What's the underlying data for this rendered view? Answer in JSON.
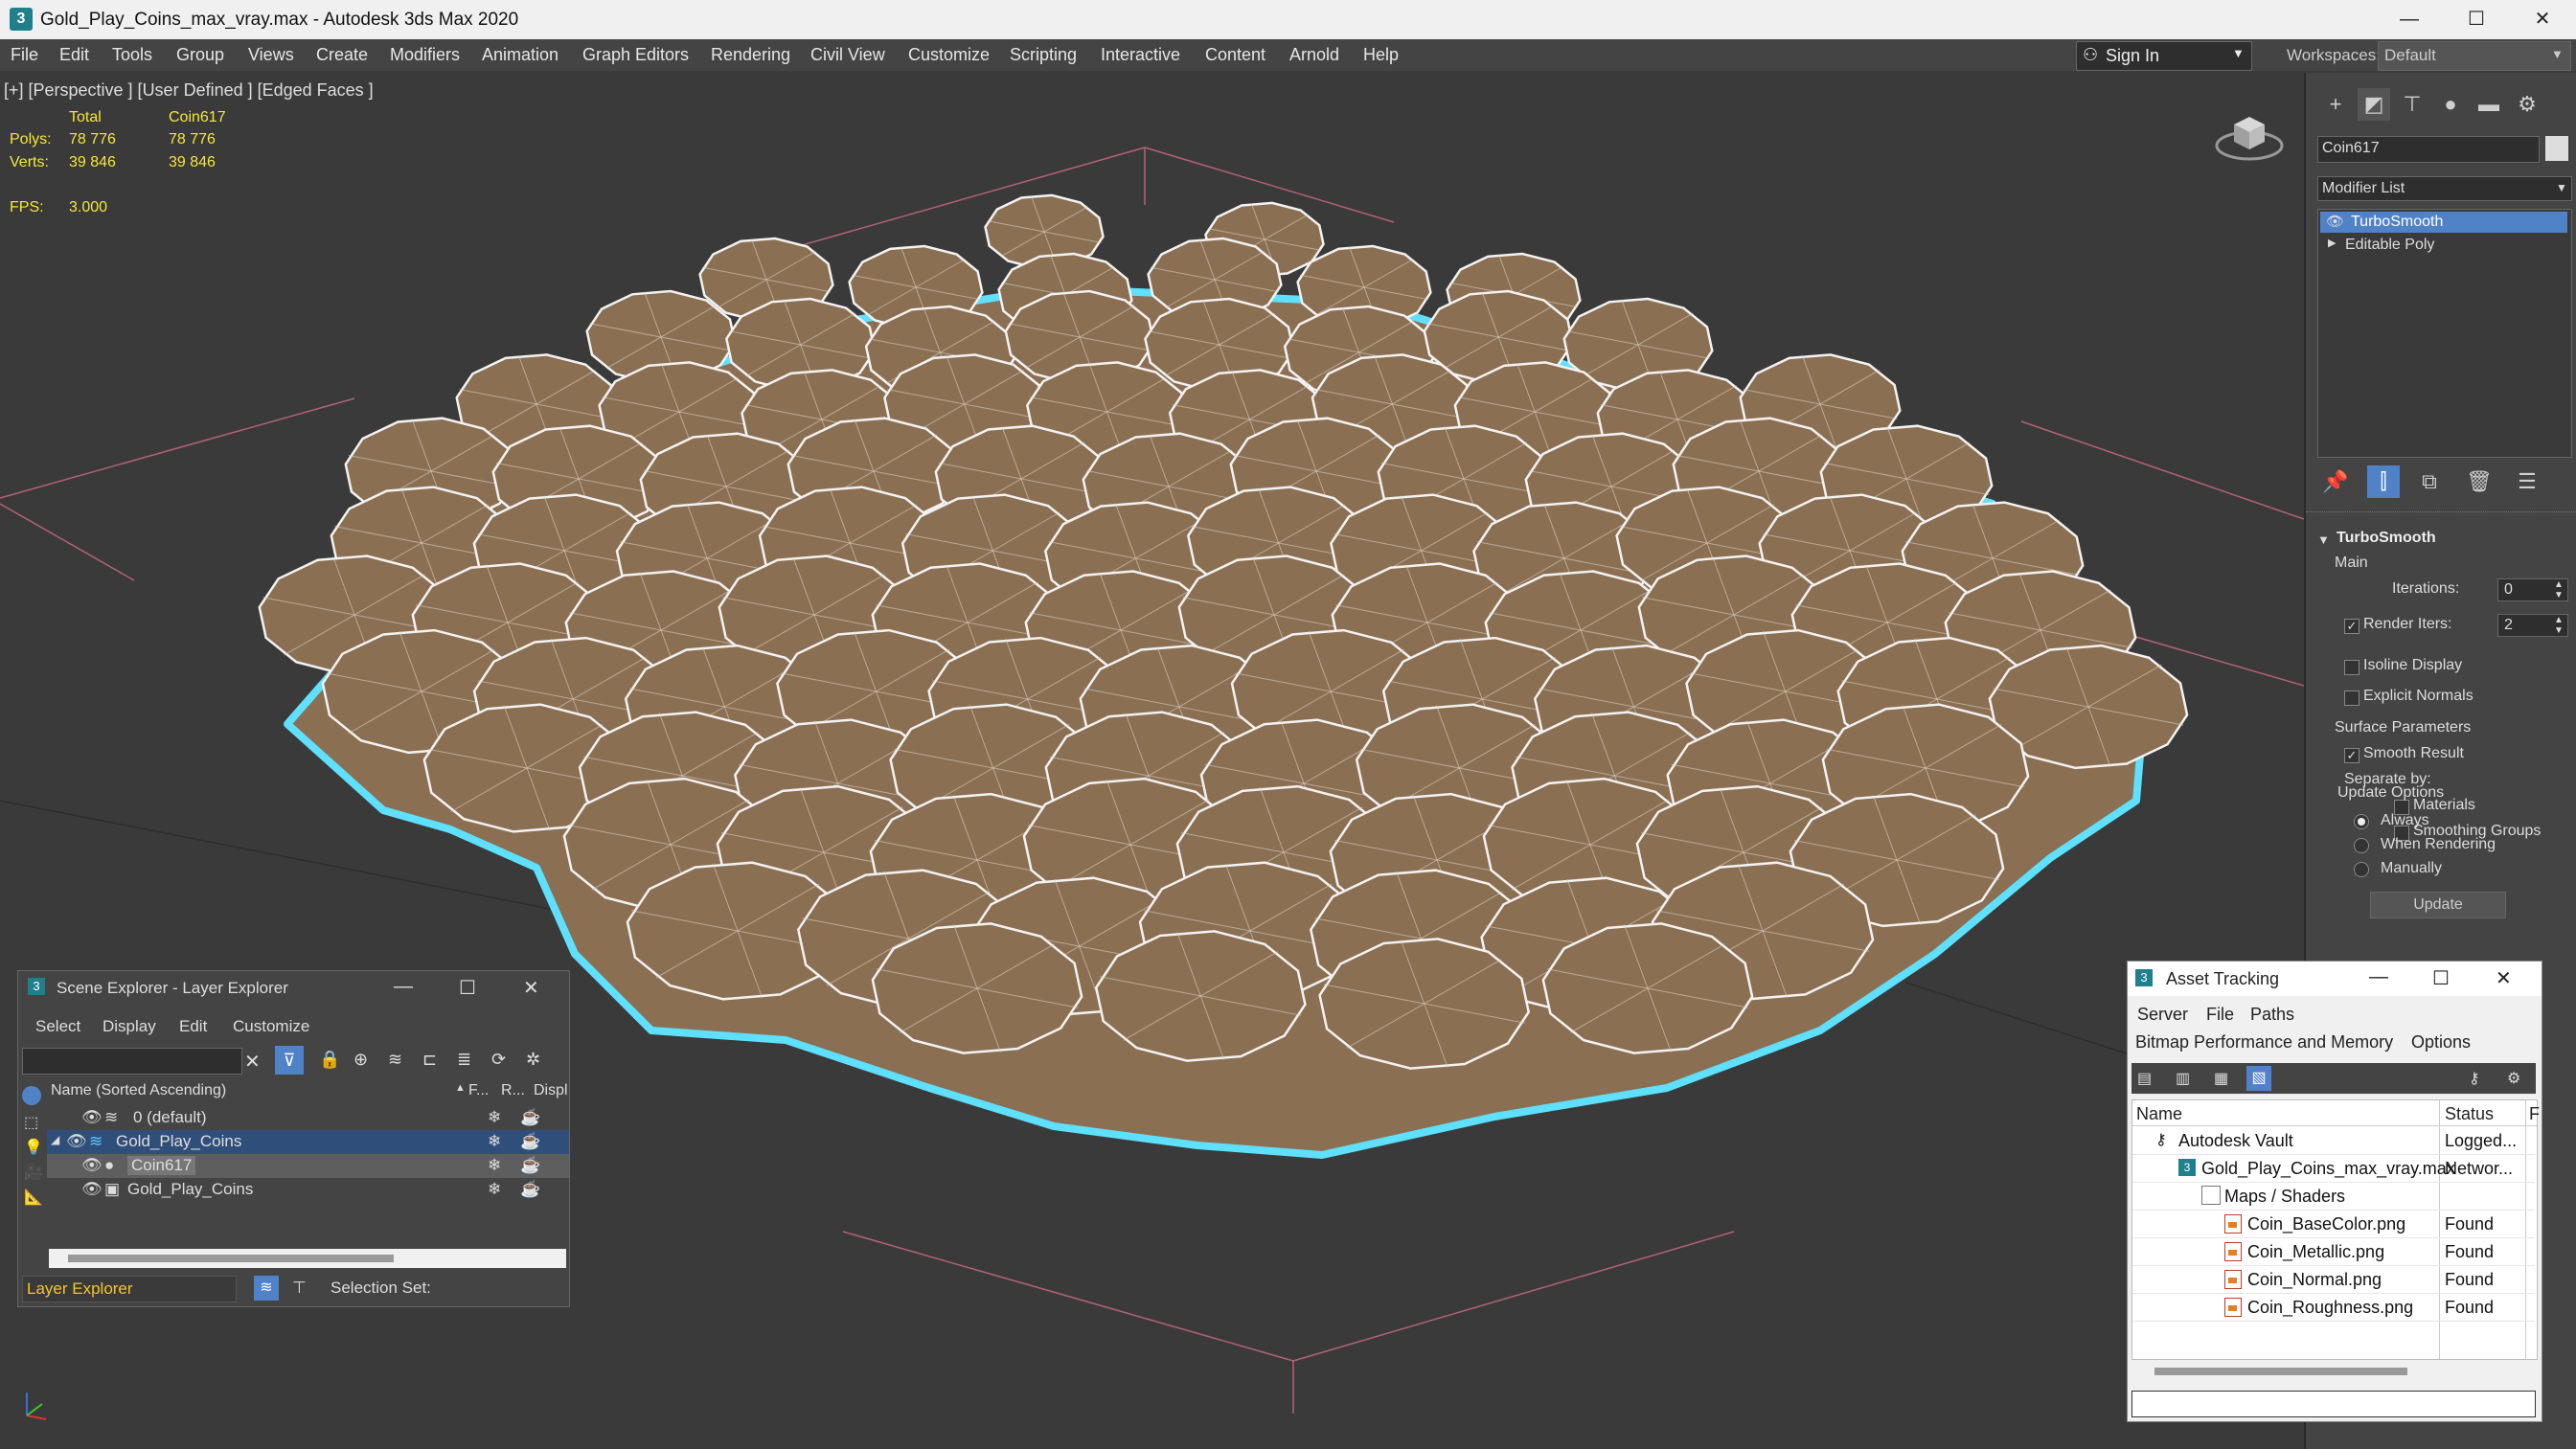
{
  "window": {
    "title": "Gold_Play_Coins_max_vray.max - Autodesk 3ds Max 2020",
    "app_icon_glyph": "3",
    "controls": {
      "minimize": "—",
      "maximize": "☐",
      "close": "✕"
    }
  },
  "menu": {
    "items": [
      "File",
      "Edit",
      "Tools",
      "Group",
      "Views",
      "Create",
      "Modifiers",
      "Animation",
      "Graph Editors",
      "Rendering",
      "Civil View",
      "Customize",
      "Scripting",
      "Interactive",
      "Content",
      "Arnold",
      "Help"
    ],
    "sign_in": "Sign In",
    "workspaces_label": "Workspaces:",
    "workspace_value": "Default"
  },
  "viewport": {
    "label": "[+] [Perspective ] [User Defined ] [Edged Faces ]",
    "stats": {
      "col_total": "Total",
      "col_object": "Coin617",
      "polys_label": "Polys:",
      "polys_total": "78 776",
      "polys_object": "78 776",
      "verts_label": "Verts:",
      "verts_total": "39 846",
      "verts_object": "39 846",
      "fps_label": "FPS:",
      "fps_value": "3.000"
    },
    "coin_color": "#8b6f52",
    "selection_color": "#5fe0ff"
  },
  "command_panel": {
    "object_name": "Coin617",
    "modifier_list": "Modifier List",
    "stack": [
      "TurboSmooth",
      "Editable Poly"
    ],
    "rollout_title": "TurboSmooth",
    "main_label": "Main",
    "iterations_label": "Iterations:",
    "iterations_value": "0",
    "render_iters_label": "Render Iters:",
    "render_iters_value": "2",
    "isoline_label": "Isoline Display",
    "explicit_normals_label": "Explicit Normals",
    "surface_params_label": "Surface Parameters",
    "smooth_result_label": "Smooth Result",
    "separate_by_label": "Separate by:",
    "materials_label": "Materials",
    "smoothing_groups_label": "Smoothing Groups",
    "update_options_label": "Update Options",
    "always_label": "Always",
    "when_rendering_label": "When Rendering",
    "manually_label": "Manually",
    "update_button": "Update"
  },
  "scene_explorer": {
    "title": "Scene Explorer - Layer Explorer",
    "menu": [
      "Select",
      "Display",
      "Edit",
      "Customize"
    ],
    "col_name": "Name (Sorted Ascending)",
    "col_f": "F...",
    "col_r": "R...",
    "col_disp": "Displ",
    "rows": [
      {
        "name": "0 (default)"
      },
      {
        "name": "Gold_Play_Coins"
      },
      {
        "name": "Coin617"
      },
      {
        "name": "Gold_Play_Coins"
      }
    ],
    "footer_explorer": "Layer Explorer",
    "footer_selection_set": "Selection Set:"
  },
  "asset_tracking": {
    "title": "Asset Tracking",
    "menu": [
      "Server",
      "File",
      "Paths"
    ],
    "menu2": [
      "Bitmap Performance and Memory",
      "Options"
    ],
    "col_name": "Name",
    "col_status": "Status",
    "col_extra": "F",
    "rows": [
      {
        "name": "Autodesk Vault",
        "status": "Logged..."
      },
      {
        "name": "Gold_Play_Coins_max_vray.max",
        "status": "Networ..."
      },
      {
        "name": "Maps / Shaders",
        "status": ""
      },
      {
        "name": "Coin_BaseColor.png",
        "status": "Found"
      },
      {
        "name": "Coin_Metallic.png",
        "status": "Found"
      },
      {
        "name": "Coin_Normal.png",
        "status": "Found"
      },
      {
        "name": "Coin_Roughness.png",
        "status": "Found"
      }
    ]
  }
}
